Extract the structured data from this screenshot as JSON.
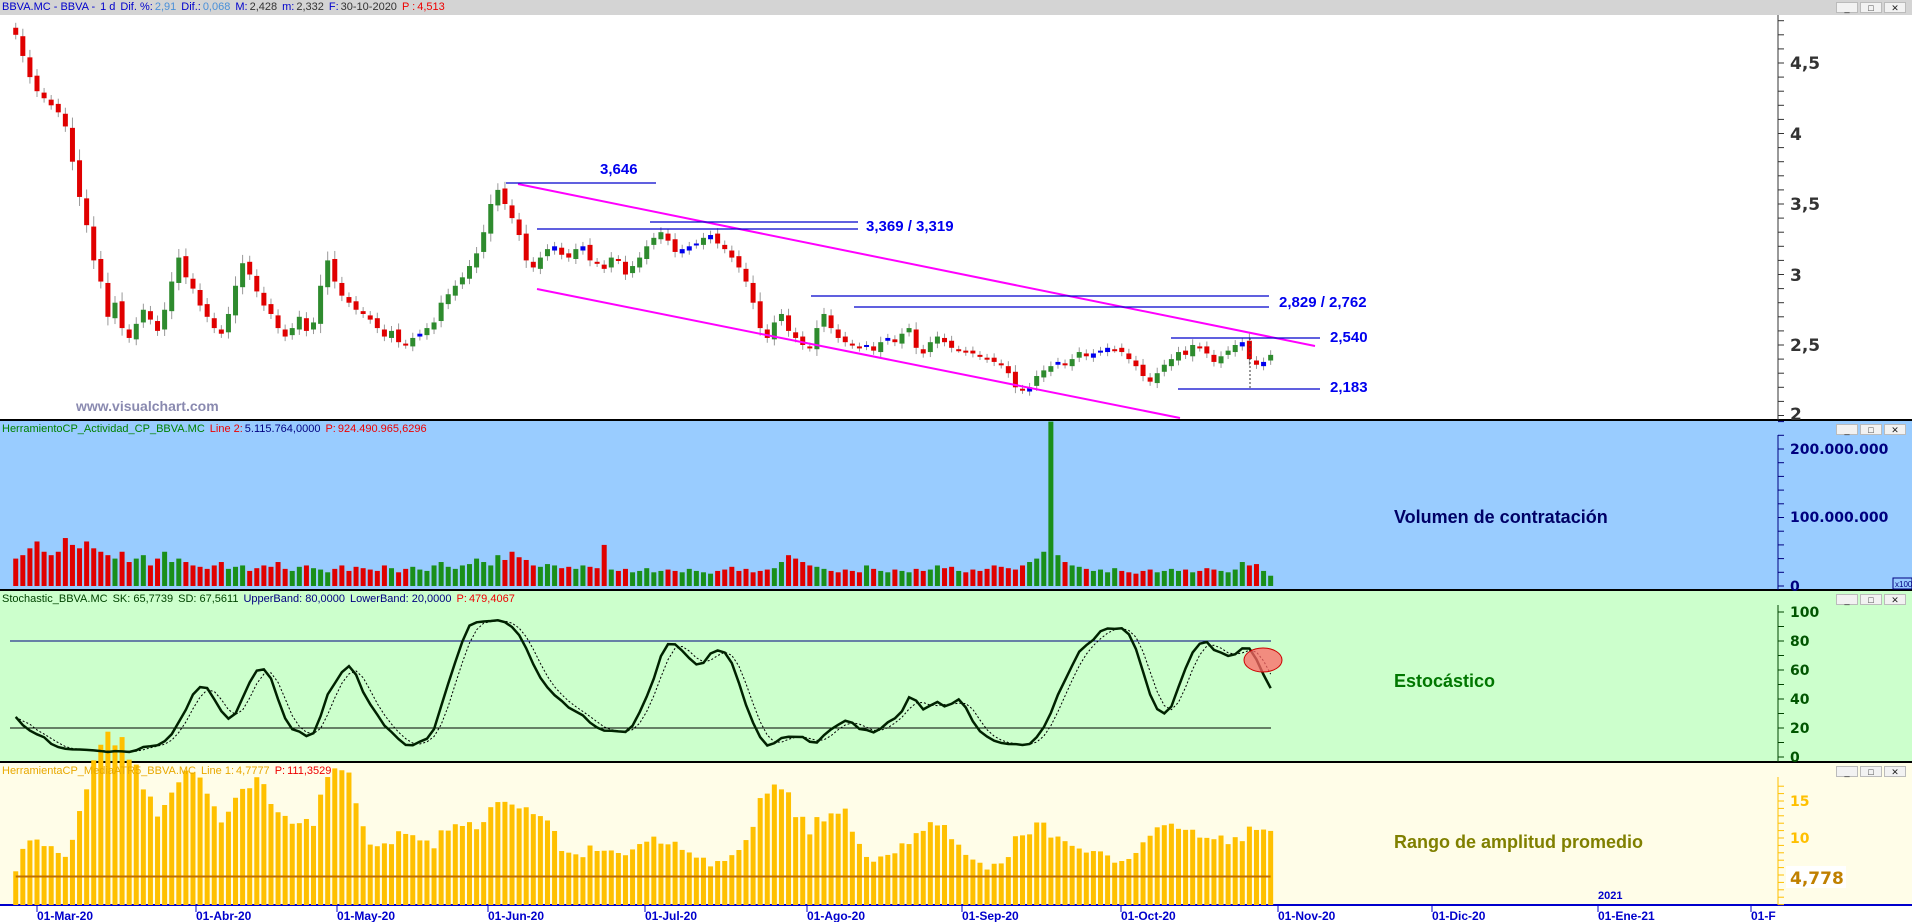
{
  "price_header": {
    "symbol": "BBVA.MC - BBVA -",
    "period": "1 d",
    "dif_pct_label": "Dif. %:",
    "dif_pct": "2,91",
    "dif_label": "Dif.:",
    "dif": "0,068",
    "max_label": "M:",
    "max": "2,428",
    "min_label": "m:",
    "min": "2,332",
    "date_label": "F:",
    "date": "30-10-2020",
    "p_label": "P :",
    "p": "4,513"
  },
  "volume_header": {
    "name": "HerramientoCP_Actividad_CP_BBVA.MC",
    "line_label": "Line 2:",
    "line_value": "5.115.764,0000",
    "p_label": "P:",
    "p": "924.490.965,6296"
  },
  "stoch_header": {
    "name": "Stochastic_BBVA.MC",
    "sk": "SK: 65,7739",
    "sd": "SD: 67,5611",
    "upper": "UpperBand: 80,0000",
    "lower": "LowerBand: 20,0000",
    "p_label": "P:",
    "p": "479,4067"
  },
  "atr_header": {
    "name": "HerramientaCP_MediaATR5_BBVA.MC",
    "line_label": "Line 1:",
    "line_value": "4,7777",
    "p_label": "P:",
    "p": "111,3529"
  },
  "window_buttons": {
    "minimize": "_",
    "maximize": "□",
    "close": "✕"
  },
  "watermark": "www.visualchart.com",
  "panel_titles": {
    "volume": "Volumen de contratación",
    "stoch": "Estocástico",
    "atr": "Rango de amplitud promedio"
  },
  "annotations": {
    "a1": "3,646",
    "a2": "3,369 / 3,319",
    "a3": "2,829 / 2,762",
    "a4": "2,540",
    "a5": "2,183"
  },
  "axes": {
    "price": [
      "4,5",
      "4",
      "3,5",
      "3",
      "2,5",
      "2"
    ],
    "volume": [
      "200.000.000",
      "100.000.000",
      "0"
    ],
    "volume_multiplier": "x100",
    "stoch": [
      "100",
      "80",
      "60",
      "40",
      "20",
      "0"
    ],
    "atr": [
      "15",
      "10"
    ],
    "atr_current": "4,778",
    "dates": [
      "01-Mar-20",
      "01-Abr-20",
      "01-May-20",
      "01-Jun-20",
      "01-Jul-20",
      "01-Ago-20",
      "01-Sep-20",
      "01-Oct-20",
      "01-Nov-20",
      "01-Dic-20",
      "01-Ene-21",
      "01-F"
    ],
    "year_marker": "2021"
  },
  "colors": {
    "up": "#2e8b2e",
    "down": "#e00000",
    "neutral": "#0000ee",
    "channel": "#ff00ff",
    "level": "#0000cc",
    "volume_bg": "#99ccff",
    "stoch_bg": "#ccffcc",
    "atr_bg": "#fffde8",
    "atr_bar": "#ffc000",
    "atr_line": "#c07000"
  },
  "chart_data": {
    "type": "candlestick",
    "start_date": "2020-02-26",
    "end_date": "2020-10-30",
    "closes": [
      4.7,
      4.55,
      4.4,
      4.3,
      4.25,
      4.2,
      4.15,
      4.05,
      3.8,
      3.55,
      3.35,
      3.1,
      2.95,
      2.7,
      2.8,
      2.62,
      2.55,
      2.65,
      2.75,
      2.68,
      2.6,
      2.75,
      2.95,
      3.12,
      2.98,
      2.9,
      2.78,
      2.7,
      2.62,
      2.58,
      2.72,
      2.92,
      3.08,
      3.0,
      2.88,
      2.78,
      2.72,
      2.62,
      2.56,
      2.62,
      2.7,
      2.6,
      2.66,
      2.92,
      3.1,
      2.95,
      2.85,
      2.8,
      2.75,
      2.72,
      2.68,
      2.62,
      2.56,
      2.6,
      2.52,
      2.5,
      2.55,
      2.58,
      2.62,
      2.66,
      2.8,
      2.86,
      2.92,
      2.98,
      3.06,
      3.15,
      3.3,
      3.5,
      3.6,
      3.5,
      3.4,
      3.28,
      3.1,
      3.05,
      3.12,
      3.18,
      3.2,
      3.14,
      3.12,
      3.18,
      3.2,
      3.1,
      3.08,
      3.04,
      3.12,
      3.1,
      3.0,
      3.06,
      3.12,
      3.2,
      3.26,
      3.3,
      3.24,
      3.16,
      3.18,
      3.2,
      3.22,
      3.26,
      3.28,
      3.22,
      3.18,
      3.12,
      3.05,
      2.95,
      2.8,
      2.62,
      2.55,
      2.66,
      2.72,
      2.6,
      2.55,
      2.5,
      2.48,
      2.62,
      2.72,
      2.62,
      2.55,
      2.52,
      2.5,
      2.48,
      2.5,
      2.46,
      2.52,
      2.55,
      2.52,
      2.58,
      2.62,
      2.48,
      2.44,
      2.52,
      2.56,
      2.52,
      2.48,
      2.47,
      2.45,
      2.44,
      2.42,
      2.4,
      2.38,
      2.36,
      2.3,
      2.2,
      2.18,
      2.2,
      2.28,
      2.32,
      2.35,
      2.38,
      2.36,
      2.4,
      2.45,
      2.42,
      2.44,
      2.46,
      2.48,
      2.47,
      2.45,
      2.4,
      2.35,
      2.28,
      2.24,
      2.3,
      2.36,
      2.4,
      2.45,
      2.43,
      2.5,
      2.48,
      2.44,
      2.38,
      2.42,
      2.46,
      2.5,
      2.52,
      2.4,
      2.36,
      2.38,
      2.43
    ],
    "volumes_millions": [
      40,
      45,
      55,
      65,
      50,
      45,
      50,
      70,
      60,
      55,
      65,
      55,
      50,
      45,
      40,
      50,
      35,
      40,
      45,
      30,
      40,
      50,
      35,
      40,
      35,
      30,
      28,
      25,
      30,
      35,
      25,
      28,
      30,
      22,
      26,
      30,
      28,
      35,
      25,
      22,
      28,
      30,
      26,
      24,
      20,
      25,
      30,
      22,
      28,
      26,
      24,
      22,
      30,
      26,
      20,
      25,
      28,
      24,
      22,
      30,
      35,
      28,
      25,
      30,
      32,
      40,
      35,
      30,
      45,
      38,
      50,
      42,
      38,
      30,
      28,
      32,
      30,
      26,
      28,
      25,
      30,
      28,
      26,
      60,
      24,
      22,
      25,
      20,
      22,
      26,
      20,
      22,
      24,
      22,
      20,
      25,
      22,
      20,
      18,
      22,
      24,
      28,
      22,
      25,
      20,
      22,
      24,
      26,
      35,
      45,
      40,
      35,
      30,
      28,
      25,
      22,
      20,
      24,
      22,
      20,
      30,
      25,
      22,
      20,
      24,
      22,
      20,
      25,
      22,
      24,
      30,
      26,
      28,
      22,
      20,
      24,
      22,
      25,
      30,
      28,
      26,
      24,
      30,
      35,
      40,
      50,
      240,
      45,
      35,
      30,
      28,
      25,
      22,
      24,
      20,
      26,
      22,
      20,
      18,
      22,
      24,
      20,
      22,
      25,
      22,
      24,
      20,
      22,
      26,
      24,
      22,
      20,
      24,
      35,
      30,
      32,
      22,
      15
    ],
    "price_ylim": [
      2,
      4.8
    ],
    "levels": [
      3.646,
      3.369,
      3.319,
      2.829,
      2.762,
      2.54,
      2.183
    ],
    "stoch_bands": [
      80,
      20
    ],
    "stoch_ylim": [
      0,
      100
    ],
    "volume_ylim": [
      0,
      250000000
    ],
    "atr_ylim": [
      0,
      17
    ]
  }
}
